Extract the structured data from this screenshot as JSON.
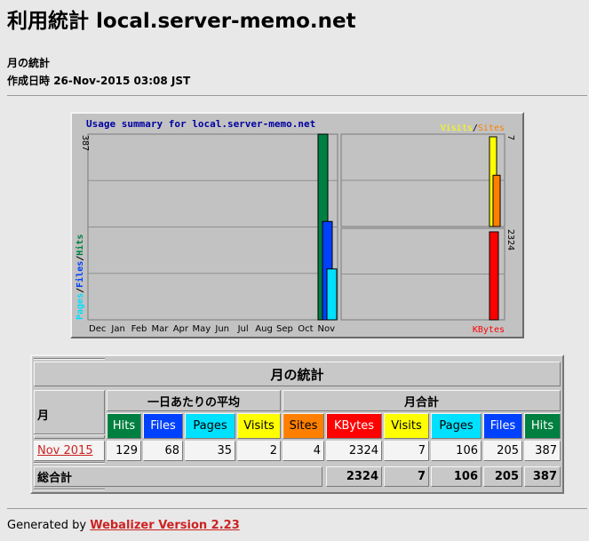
{
  "page": {
    "title": "利用統計 local.server-memo.net",
    "subtitle": "月の統計",
    "generated_label": "作成日時",
    "generated_value": "26-Nov-2015 03:08 JST"
  },
  "chart": {
    "title": "Usage summary for local.server-memo.net",
    "left_axis_max": "387",
    "left_legend": [
      "Pages",
      "Files",
      "Hits"
    ],
    "right_top_legend": [
      "Visits",
      "Sites"
    ],
    "right_top_max": "7",
    "right_bottom_max": "2324",
    "right_bottom_label": "KBytes",
    "legend_separator": "/",
    "colors": {
      "hits": "#008040",
      "files": "#0040ff",
      "pages": "#00e0ff",
      "visits": "#ffff00",
      "sites": "#ff8000",
      "kbytes": "#ff0000",
      "title_text": "#0000a0"
    }
  },
  "chart_data": {
    "type": "bar",
    "categories": [
      "Dec",
      "Jan",
      "Feb",
      "Mar",
      "Apr",
      "May",
      "Jun",
      "Jul",
      "Aug",
      "Sep",
      "Oct",
      "Nov"
    ],
    "title": "Usage summary for local.server-memo.net",
    "panels": [
      {
        "name": "left",
        "ylim": [
          0,
          387
        ],
        "series": [
          {
            "name": "Hits",
            "values": [
              0,
              0,
              0,
              0,
              0,
              0,
              0,
              0,
              0,
              0,
              0,
              387
            ]
          },
          {
            "name": "Files",
            "values": [
              0,
              0,
              0,
              0,
              0,
              0,
              0,
              0,
              0,
              0,
              0,
              205
            ]
          },
          {
            "name": "Pages",
            "values": [
              0,
              0,
              0,
              0,
              0,
              0,
              0,
              0,
              0,
              0,
              0,
              106
            ]
          }
        ]
      },
      {
        "name": "right-top",
        "ylim": [
          0,
          7
        ],
        "series": [
          {
            "name": "Visits",
            "values": [
              0,
              0,
              0,
              0,
              0,
              0,
              0,
              0,
              0,
              0,
              0,
              7
            ]
          },
          {
            "name": "Sites",
            "values": [
              0,
              0,
              0,
              0,
              0,
              0,
              0,
              0,
              0,
              0,
              0,
              4
            ]
          }
        ]
      },
      {
        "name": "right-bottom",
        "ylim": [
          0,
          2324
        ],
        "series": [
          {
            "name": "KBytes",
            "values": [
              0,
              0,
              0,
              0,
              0,
              0,
              0,
              0,
              0,
              0,
              0,
              2324
            ]
          }
        ]
      }
    ]
  },
  "table": {
    "caption": "月の統計",
    "month_header": "月",
    "avg_header": "一日あたりの平均",
    "total_header": "月合計",
    "col_headers": [
      {
        "label": "Hits",
        "color": "#008040"
      },
      {
        "label": "Files",
        "color": "#0040ff"
      },
      {
        "label": "Pages",
        "color": "#00e0ff"
      },
      {
        "label": "Visits",
        "color": "#ffff00"
      },
      {
        "label": "Sites",
        "color": "#ff8000"
      },
      {
        "label": "KBytes",
        "color": "#ff0000"
      },
      {
        "label": "Visits",
        "color": "#ffff00"
      },
      {
        "label": "Pages",
        "color": "#00e0ff"
      },
      {
        "label": "Files",
        "color": "#0040ff"
      },
      {
        "label": "Hits",
        "color": "#008040"
      }
    ],
    "rows": [
      {
        "month": "Nov 2015",
        "values": [
          "129",
          "68",
          "35",
          "2",
          "4",
          "2324",
          "7",
          "106",
          "205",
          "387"
        ]
      }
    ],
    "totals": {
      "label": "総合計",
      "values": [
        "2324",
        "7",
        "106",
        "205",
        "387"
      ]
    }
  },
  "footer": {
    "prefix": "Generated by",
    "link": "Webalizer Version 2.23"
  }
}
